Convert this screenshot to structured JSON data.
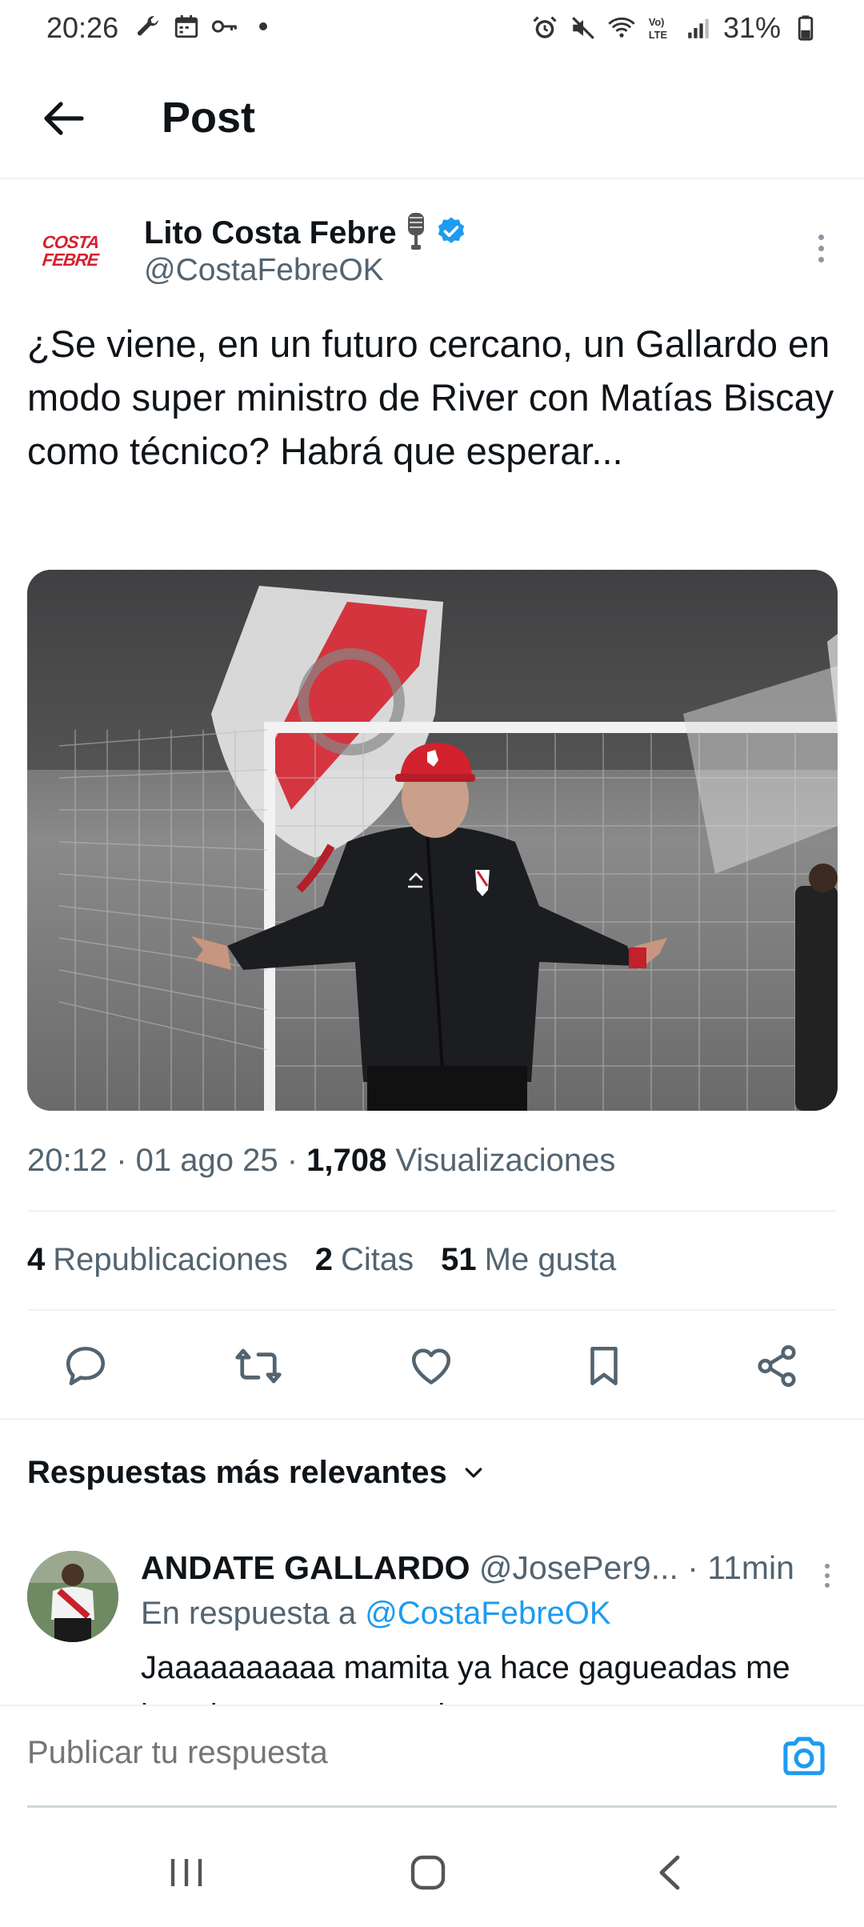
{
  "status_bar": {
    "time": "20:26",
    "battery": "31%",
    "icons": [
      "wrench-icon",
      "calendar-icon",
      "key-icon",
      "dot-icon",
      "alarm-icon",
      "mute-icon",
      "wifi-icon",
      "volte-icon",
      "signal-icon",
      "battery-icon"
    ]
  },
  "header": {
    "title": "Post"
  },
  "post": {
    "avatar_text_line1": "COSTA",
    "avatar_text_line2": "FEBRE",
    "author_name": "Lito Costa Febre",
    "author_handle": "@CostaFebreOK",
    "text": "¿Se viene, en un futuro cercano, un Gallardo en modo super ministro de River con Matías Biscay como técnico? Habrá que esperar...",
    "timestamp": "20:12 · 01 ago 25 · ",
    "views_count": "1,708",
    "views_label": "Visualizaciones",
    "reposts_count": "4",
    "reposts_label": "Republicaciones",
    "quotes_count": "2",
    "quotes_label": "Citas",
    "likes_count": "51",
    "likes_label": "Me gusta"
  },
  "replies": {
    "sort_label": "Respuestas más relevantes",
    "items": [
      {
        "name": "ANDATE GALLARDO",
        "handle": "@JosePer9...",
        "time": " · 11min",
        "reply_to_prefix": "En respuesta a ",
        "reply_to_handle": "@CostaFebreOK",
        "text": "Jaaaaaaaaaa mamita ya hace gagueadas me imagino con mas poder"
      }
    ]
  },
  "composer": {
    "placeholder": "Publicar tu respuesta"
  },
  "colors": {
    "accent": "#1d9bf0",
    "secondary_text": "#536471",
    "primary_text": "#0f1419",
    "divider": "#eff3f4",
    "river_red": "#d6202d"
  }
}
